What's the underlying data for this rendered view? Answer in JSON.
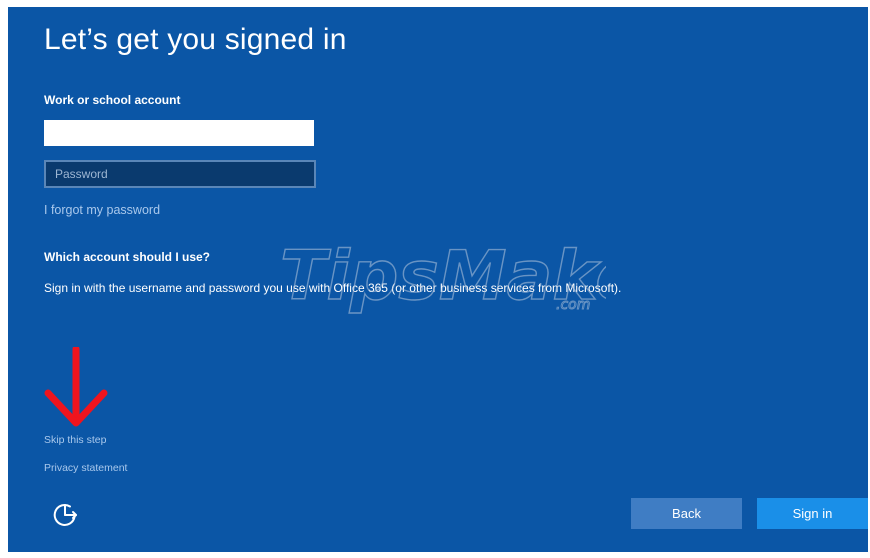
{
  "page": {
    "title": "Let’s get you signed in"
  },
  "form": {
    "account_label": "Work or school account",
    "account_value": "",
    "password_placeholder": "Password",
    "forgot_link": "I forgot my password"
  },
  "help": {
    "heading": "Which account should I use?",
    "text": "Sign in with the username and password you use with Office 365 (or other business services from Microsoft)."
  },
  "footer": {
    "skip_link": "Skip this step",
    "privacy_link": "Privacy statement",
    "back_label": "Back",
    "signin_label": "Sign in",
    "ease_of_access_icon": "ease-of-access-icon"
  },
  "annotation": {
    "arrow_icon": "red-arrow-down-icon",
    "arrow_color": "#f0141e"
  },
  "watermark": {
    "main": "TipsMake",
    "sub": ".com"
  },
  "colors": {
    "background": "#0b56a6",
    "link": "#a9c8ec",
    "back_button": "#3f7dc4",
    "signin_button": "#1a8fe8",
    "password_field": "#0a3a6e"
  }
}
